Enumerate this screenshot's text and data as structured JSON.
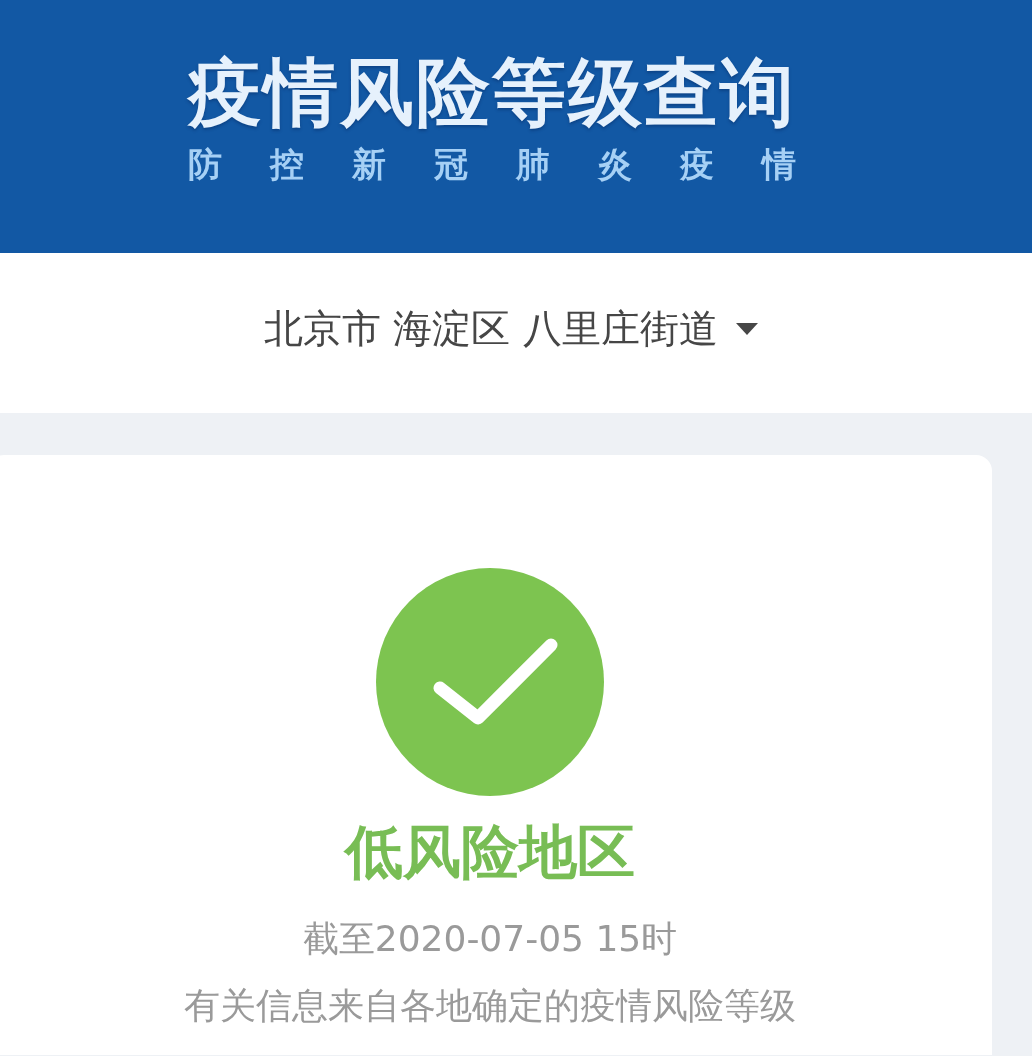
{
  "header": {
    "title": "疫情风险等级查询",
    "subtitle": "防控新冠肺炎疫情"
  },
  "location": {
    "value": "北京市 海淀区 八里庄街道"
  },
  "risk": {
    "kind": "low",
    "label": "低风险地区",
    "as_of": "截至2020-07-05 15时",
    "note": "有关信息来自各地确定的疫情风险等级"
  }
}
